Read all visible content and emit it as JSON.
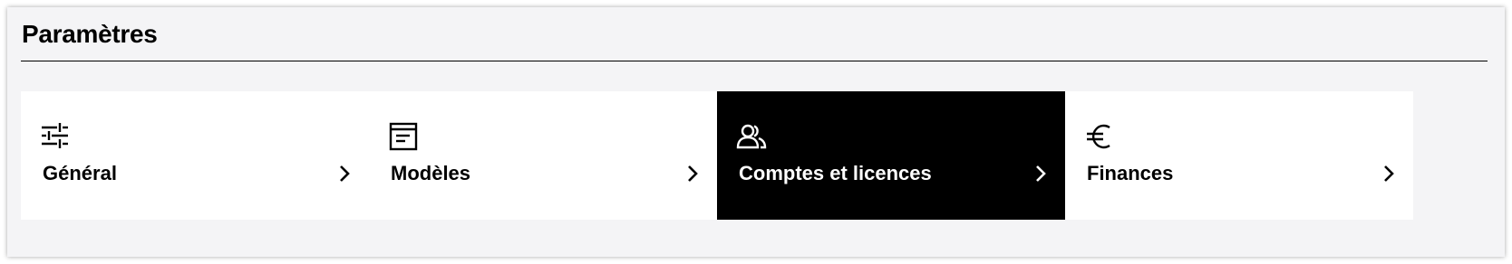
{
  "page": {
    "title": "Paramètres"
  },
  "cards": [
    {
      "label": "Général",
      "icon": "sliders-icon",
      "active": false
    },
    {
      "label": "Modèles",
      "icon": "template-icon",
      "active": false
    },
    {
      "label": "Comptes et licences",
      "icon": "users-icon",
      "active": true
    },
    {
      "label": "Finances",
      "icon": "euro-icon",
      "active": false
    }
  ],
  "colors": {
    "panel_background": "#f4f4f6",
    "card_background": "#ffffff",
    "active_card_background": "#000000",
    "text": "#000000",
    "active_text": "#ffffff"
  }
}
